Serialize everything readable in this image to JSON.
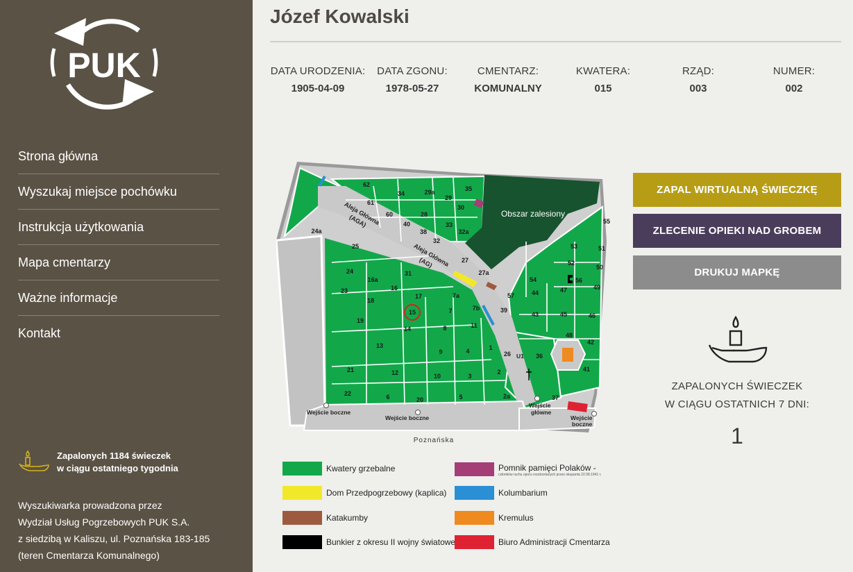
{
  "sidebar": {
    "logo_text": "PUK",
    "nav": [
      "Strona główna",
      "Wyszukaj miejsce pochówku",
      "Instrukcja użytkowania",
      "Mapa cmentarzy",
      "Ważne informacje",
      "Kontakt"
    ],
    "candles_note_line1": "Zapalonych 1184 świeczek",
    "candles_note_line2": "w ciągu ostatniego tygodnia",
    "footer_lines": [
      "Wyszukiwarka prowadzona przez",
      "Wydział Usług Pogrzebowych PUK S.A.",
      "z siedzibą w Kaliszu, ul. Poznańska 183-185",
      "(teren Cmentarza Komunalnego)"
    ]
  },
  "person": {
    "name": "Józef Kowalski",
    "fields": [
      {
        "label": "DATA URODZENIA:",
        "value": "1905-04-09"
      },
      {
        "label": "DATA ZGONU:",
        "value": "1978-05-27"
      },
      {
        "label": "CMENTARZ:",
        "value": "KOMUNALNY"
      },
      {
        "label": "KWATERA:",
        "value": "015"
      },
      {
        "label": "RZĄD:",
        "value": "003"
      },
      {
        "label": "NUMER:",
        "value": "002"
      }
    ]
  },
  "buttons": {
    "candle": "ZAPAL WIRTUALNĄ ŚWIECZKĘ",
    "care": "ZLECENIE OPIEKI NAD GROBEM",
    "print": "DRUKUJ MAPKĘ"
  },
  "candles": {
    "label_line1": "ZAPALONYCH ŚWIECZEK",
    "label_line2": "W CIĄGU OSTATNICH 7 DNI:",
    "count": "1"
  },
  "map": {
    "forest_label": "Obszar zalesiony",
    "alley1_line1": "Aleja Główna",
    "alley1_line2": "(AGA)",
    "alley2_line1": "Aleja Główna",
    "alley2_line2": "(AG)",
    "street": "Poznańska",
    "entrances": [
      "Wejście boczne",
      "Wejście boczne",
      "Wejście",
      "główne",
      "Wejście",
      "boczne",
      "U1"
    ],
    "highlighted_quarter": "15",
    "quarters": [
      "62",
      "34",
      "29a",
      "29",
      "35",
      "61",
      "60",
      "28",
      "30",
      "24a",
      "40",
      "38",
      "33",
      "25",
      "32",
      "32a",
      "27",
      "27a",
      "24",
      "16a",
      "16",
      "31",
      "23",
      "18",
      "17",
      "7a",
      "15",
      "7",
      "7b",
      "19",
      "14",
      "8",
      "11",
      "39",
      "13",
      "9",
      "4",
      "1",
      "26",
      "36",
      "21",
      "12",
      "10",
      "3",
      "2",
      "22",
      "6",
      "20",
      "5",
      "2a",
      "37",
      "55",
      "53",
      "51",
      "52",
      "50",
      "54",
      "56",
      "49",
      "44",
      "47",
      "43",
      "45",
      "46",
      "48",
      "42",
      "41",
      "57"
    ],
    "colors": {
      "grave": "#12a84a",
      "forest": "#17532e",
      "path": "#c9c9c9",
      "chapel": "#f2e82a",
      "catacombs": "#9d5a3f",
      "bunker": "#000000",
      "monument": "#a53d77",
      "columbarium": "#2a8fd4",
      "crematorium": "#ef8a21",
      "office": "#df2231"
    }
  },
  "legend": [
    {
      "label": "Kwatery grzebalne",
      "color": "#12a84a"
    },
    {
      "label": "Pomnik pamięci Polaków -",
      "sub": "członków ruchu oporu rozstrzelanych przez okupanta 22.08.1941 r.",
      "color": "#a53d77"
    },
    {
      "label": "Dom Przedpogrzebowy (kaplica)",
      "color": "#f2e82a"
    },
    {
      "label": "Kolumbarium",
      "color": "#2a8fd4"
    },
    {
      "label": "Katakumby",
      "color": "#9d5a3f"
    },
    {
      "label": "Kremulus",
      "color": "#ef8a21"
    },
    {
      "label": "Bunkier z okresu II wojny światowej",
      "color": "#000000"
    },
    {
      "label": "Biuro Administracji Cmentarza",
      "color": "#df2231"
    }
  ]
}
